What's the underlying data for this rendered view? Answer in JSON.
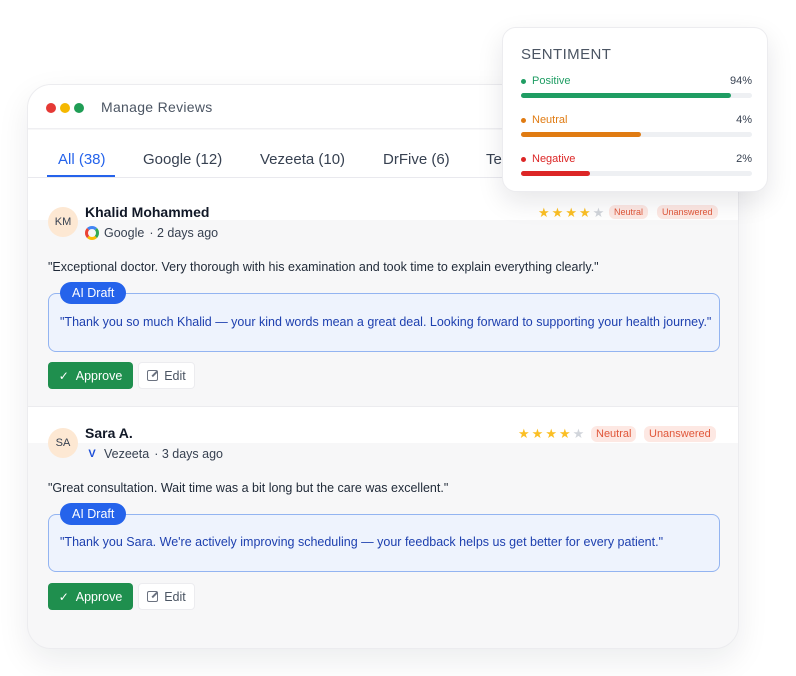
{
  "window": {
    "title": "Manage Reviews"
  },
  "tabs": [
    {
      "label": "All (38)",
      "active": true
    },
    {
      "label": "Google (12)",
      "active": false
    },
    {
      "label": "Vezeeta (10)",
      "active": false
    },
    {
      "label": "DrFive (6)",
      "active": false
    },
    {
      "label": "Te",
      "active": false
    }
  ],
  "reviews": [
    {
      "initials": "KM",
      "name": "Khalid Mohammed",
      "source": "Google",
      "source_icon": "google-logo-icon",
      "time": "· 2 days ago",
      "rating": 4,
      "max_rating": 5,
      "badges": [
        "Neutral",
        "Unanswered"
      ],
      "text": "\"Exceptional doctor. Very thorough with his examination and took time to explain everything clearly.\"",
      "draft_label": "AI Draft",
      "draft_text": "\"Thank you so much Khalid — your kind words mean a great deal. Looking forward to supporting your health journey.\"",
      "approve_label": "Approve",
      "edit_label": "Edit"
    },
    {
      "initials": "SA",
      "name": "Sara A.",
      "source": "Vezeeta",
      "source_icon": "vezeeta-logo-icon",
      "source_icon_glyph": "V",
      "time": "· 3 days ago",
      "rating": 4,
      "max_rating": 5,
      "badges": [
        "Neutral",
        "Unanswered"
      ],
      "text": "\"Great consultation. Wait time was a bit long but the care was excellent.\"",
      "draft_label": "AI Draft",
      "draft_text": "\"Thank you Sara. We're actively improving scheduling — your feedback helps us get better for every patient.\"",
      "approve_label": "Approve",
      "edit_label": "Edit"
    }
  ],
  "sentiment": {
    "title": "SENTIMENT",
    "rows": [
      {
        "label": "Positive",
        "percent_text": "94%",
        "fill_fraction": 0.91,
        "color": "#1f9d63"
      },
      {
        "label": "Neutral",
        "percent_text": "4%",
        "fill_fraction": 0.52,
        "color": "#e07b12"
      },
      {
        "label": "Negative",
        "percent_text": "2%",
        "fill_fraction": 0.3,
        "color": "#dc2626"
      }
    ]
  },
  "colors": {
    "accent": "#2563eb",
    "approve": "#1f8f4e",
    "star": "#fbbf24",
    "badge_text": "#e0573a",
    "badge_bg": "#fde8e3"
  }
}
